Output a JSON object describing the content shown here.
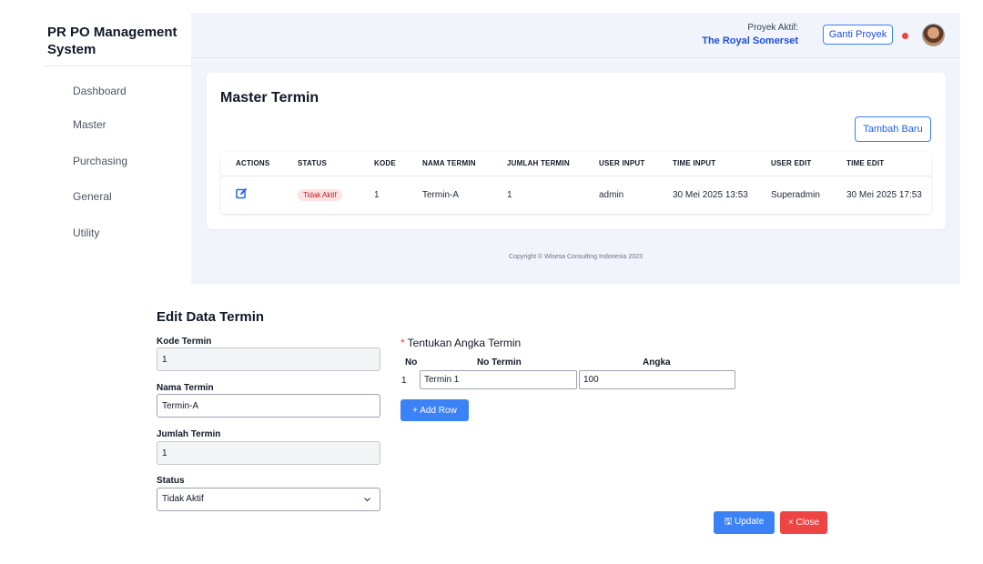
{
  "app": {
    "title": "PR PO Management System"
  },
  "sidebar": {
    "items": [
      {
        "label": "Dashboard"
      },
      {
        "label": "Master"
      },
      {
        "label": "Purchasing"
      },
      {
        "label": "General"
      },
      {
        "label": "Utility"
      }
    ]
  },
  "header": {
    "project_label": "Proyek Aktif:",
    "project_name": "The Royal Somerset",
    "change_project_label": "Ganti Proyek",
    "notification_color": "#ef4444",
    "avatar_icon": "user-avatar"
  },
  "master": {
    "title": "Master Termin",
    "add_button_label": "Tambah Baru",
    "columns": [
      "ACTIONS",
      "STATUS",
      "KODE",
      "NAMA TERMIN",
      "JUMLAH TERMIN",
      "USER INPUT",
      "TIME INPUT",
      "USER EDIT",
      "TIME EDIT"
    ],
    "rows": [
      {
        "action_icon": "edit-icon",
        "status": "Tidak Aktif",
        "kode": "1",
        "nama_termin": "Termin-A",
        "jumlah_termin": "1",
        "user_input": "admin",
        "time_input": "30 Mei 2025 13:53",
        "user_edit": "Superadmin",
        "time_edit": "30 Mei 2025 17:53"
      }
    ]
  },
  "footer": {
    "copyright": "Copyright © Wisesa Consulting Indonesia 2023"
  },
  "edit_form": {
    "title": "Edit Data Termin",
    "kode_label": "Kode Termin",
    "kode_value": "1",
    "nama_label": "Nama Termin",
    "nama_value": "Termin-A",
    "jumlah_label": "Jumlah Termin",
    "jumlah_value": "1",
    "status_label": "Status",
    "status_value": "Tidak Aktif",
    "angka": {
      "required_mark": "*",
      "title": "Tentukan Angka Termin",
      "col_no": "No",
      "col_no_termin": "No Termin",
      "col_angka": "Angka",
      "rows": [
        {
          "no": "1",
          "no_termin": "Termin 1",
          "angka": "100"
        }
      ],
      "add_row_label": "+ Add Row"
    },
    "update_label": "🖫 Update",
    "close_label": "× Close"
  },
  "colors": {
    "primary": "#3b82f6",
    "danger": "#ef4444",
    "brand_text": "#1d4ed8"
  }
}
